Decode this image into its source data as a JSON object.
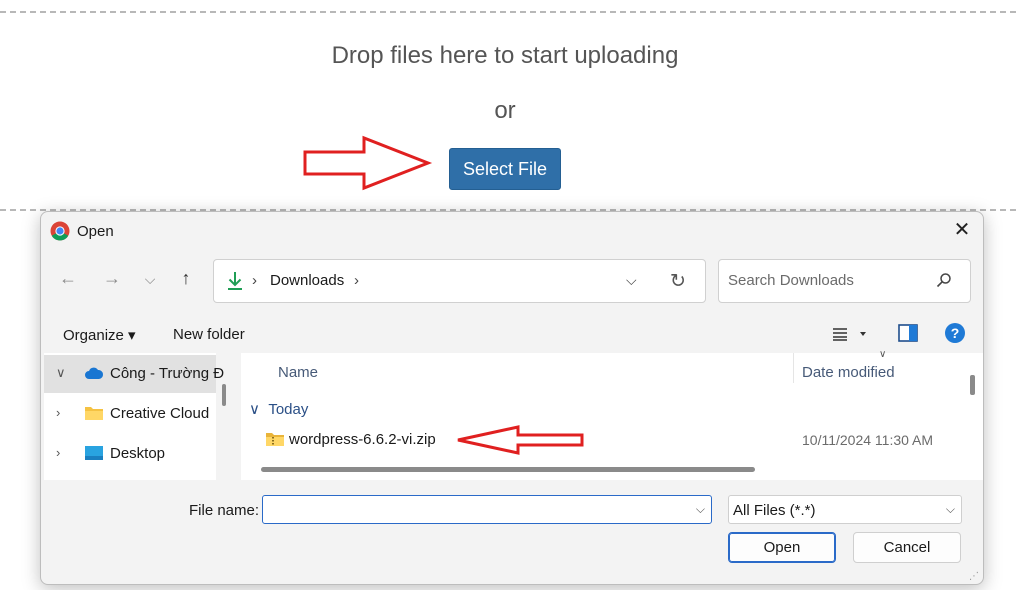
{
  "upload": {
    "drop_text": "Drop files here to start uploading",
    "or_text": "or",
    "select_button": "Select File",
    "button_color": "#2f6fa8",
    "annotation_arrow_color": "#e02020"
  },
  "dialog": {
    "title": "Open",
    "title_icon": "chrome-icon",
    "close_icon": "close-icon",
    "nav": {
      "back_icon": "arrow-left-icon",
      "forward_icon": "arrow-right-icon",
      "recent_icon": "chevron-down-icon",
      "up_icon": "arrow-up-icon"
    },
    "address": {
      "folder_icon": "downloads-icon",
      "separator": "›",
      "location": "Downloads",
      "trailing_separator": "›"
    },
    "search": {
      "placeholder": "Search Downloads"
    },
    "toolbar": {
      "organize": "Organize ▾",
      "new_folder": "New folder",
      "view_icon": "view-menu-icon",
      "preview_icon": "preview-pane-icon",
      "help_icon": "help-icon",
      "help_glyph": "?"
    },
    "nav_pane": {
      "items": [
        {
          "label": "Công - Trường Đ",
          "icon": "onedrive-icon",
          "expanded": true,
          "selected": true
        },
        {
          "label": "Creative Cloud",
          "icon": "folder-icon",
          "expanded": false,
          "selected": false
        },
        {
          "label": "Desktop",
          "icon": "desktop-icon",
          "expanded": false,
          "selected": false
        }
      ]
    },
    "file_list": {
      "columns": {
        "name": "Name",
        "date_modified": "Date modified"
      },
      "group": "Today",
      "files": [
        {
          "name": "wordpress-6.6.2-vi.zip",
          "date": "10/11/2024 11:30 AM",
          "icon": "zip-folder-icon"
        }
      ]
    },
    "bottom": {
      "file_name_label": "File name:",
      "file_name_value": "",
      "file_type": "All Files (*.*)",
      "open_button": "Open",
      "cancel_button": "Cancel"
    }
  }
}
